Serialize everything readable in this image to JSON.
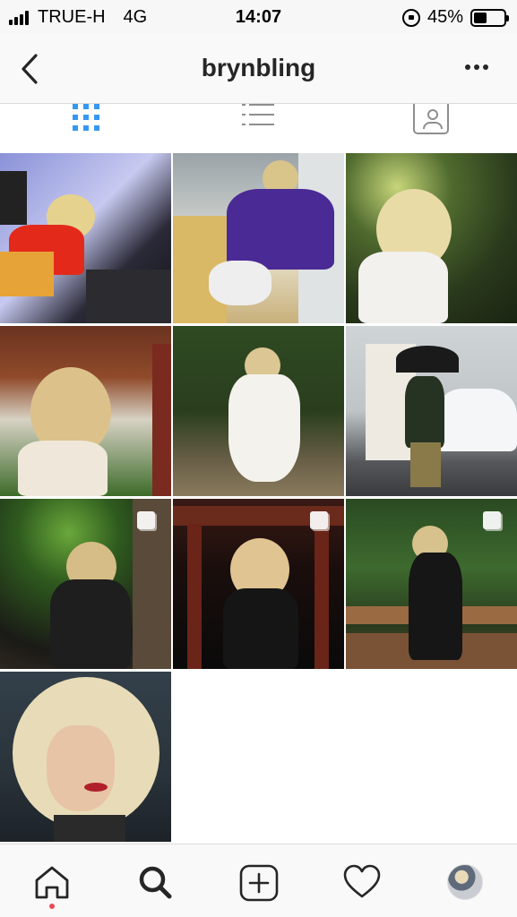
{
  "status_bar": {
    "carrier": "TRUE-H",
    "network": "4G",
    "time": "14:07",
    "battery_percent": "45%",
    "battery_level": 0.45
  },
  "header": {
    "username": "brynbling",
    "back_icon": "chevron-left-icon",
    "more_icon": "more-horizontal-icon"
  },
  "tabs": [
    {
      "icon": "grid-icon",
      "active": true
    },
    {
      "icon": "list-icon",
      "active": false
    },
    {
      "icon": "tagged-icon",
      "active": false
    }
  ],
  "posts": [
    {
      "id": 1,
      "multiple": false
    },
    {
      "id": 2,
      "multiple": false
    },
    {
      "id": 3,
      "multiple": false
    },
    {
      "id": 4,
      "multiple": false
    },
    {
      "id": 5,
      "multiple": false
    },
    {
      "id": 6,
      "multiple": false
    },
    {
      "id": 7,
      "multiple": true
    },
    {
      "id": 8,
      "multiple": true
    },
    {
      "id": 9,
      "multiple": true
    },
    {
      "id": 10,
      "multiple": false
    }
  ],
  "bottom_nav": [
    {
      "icon": "home-icon",
      "active": true,
      "notification_dot": true
    },
    {
      "icon": "search-icon",
      "active": false
    },
    {
      "icon": "add-post-icon",
      "active": false
    },
    {
      "icon": "heart-icon",
      "active": false
    },
    {
      "icon": "profile-avatar",
      "active": false
    }
  ],
  "colors": {
    "accent": "#3897f0",
    "notification": "#ed4956",
    "icon_gray": "#8e8e8e"
  }
}
